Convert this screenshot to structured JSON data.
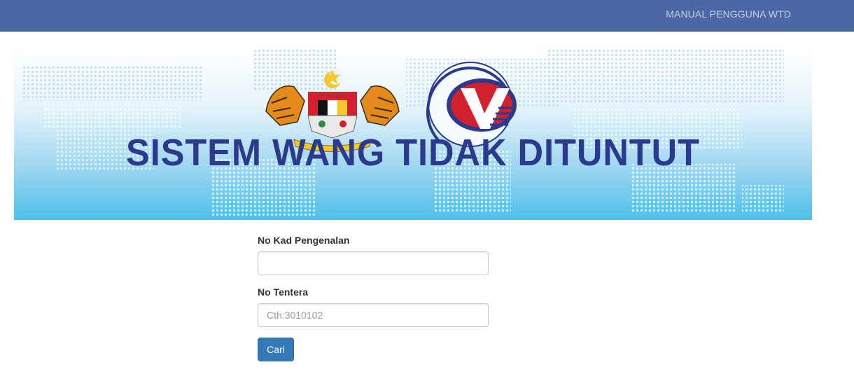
{
  "navbar": {
    "manual_link": "MANUAL PENGGUNA WTD"
  },
  "banner": {
    "title": "SISTEM WANG TIDAK DITUNTUT",
    "logo_left": "malaysia-coat-of-arms",
    "logo_right": "jabatan-hal-ehwal-veteran-logo"
  },
  "form": {
    "ic_label": "No Kad Pengenalan",
    "ic_value": "",
    "ic_placeholder": "",
    "army_label": "No Tentera",
    "army_value": "",
    "army_placeholder": "Cth:3010102",
    "submit_label": "Cari"
  },
  "colors": {
    "navbar": "#4a68a6",
    "banner_title": "#2b3a8c",
    "button": "#337ab7"
  }
}
